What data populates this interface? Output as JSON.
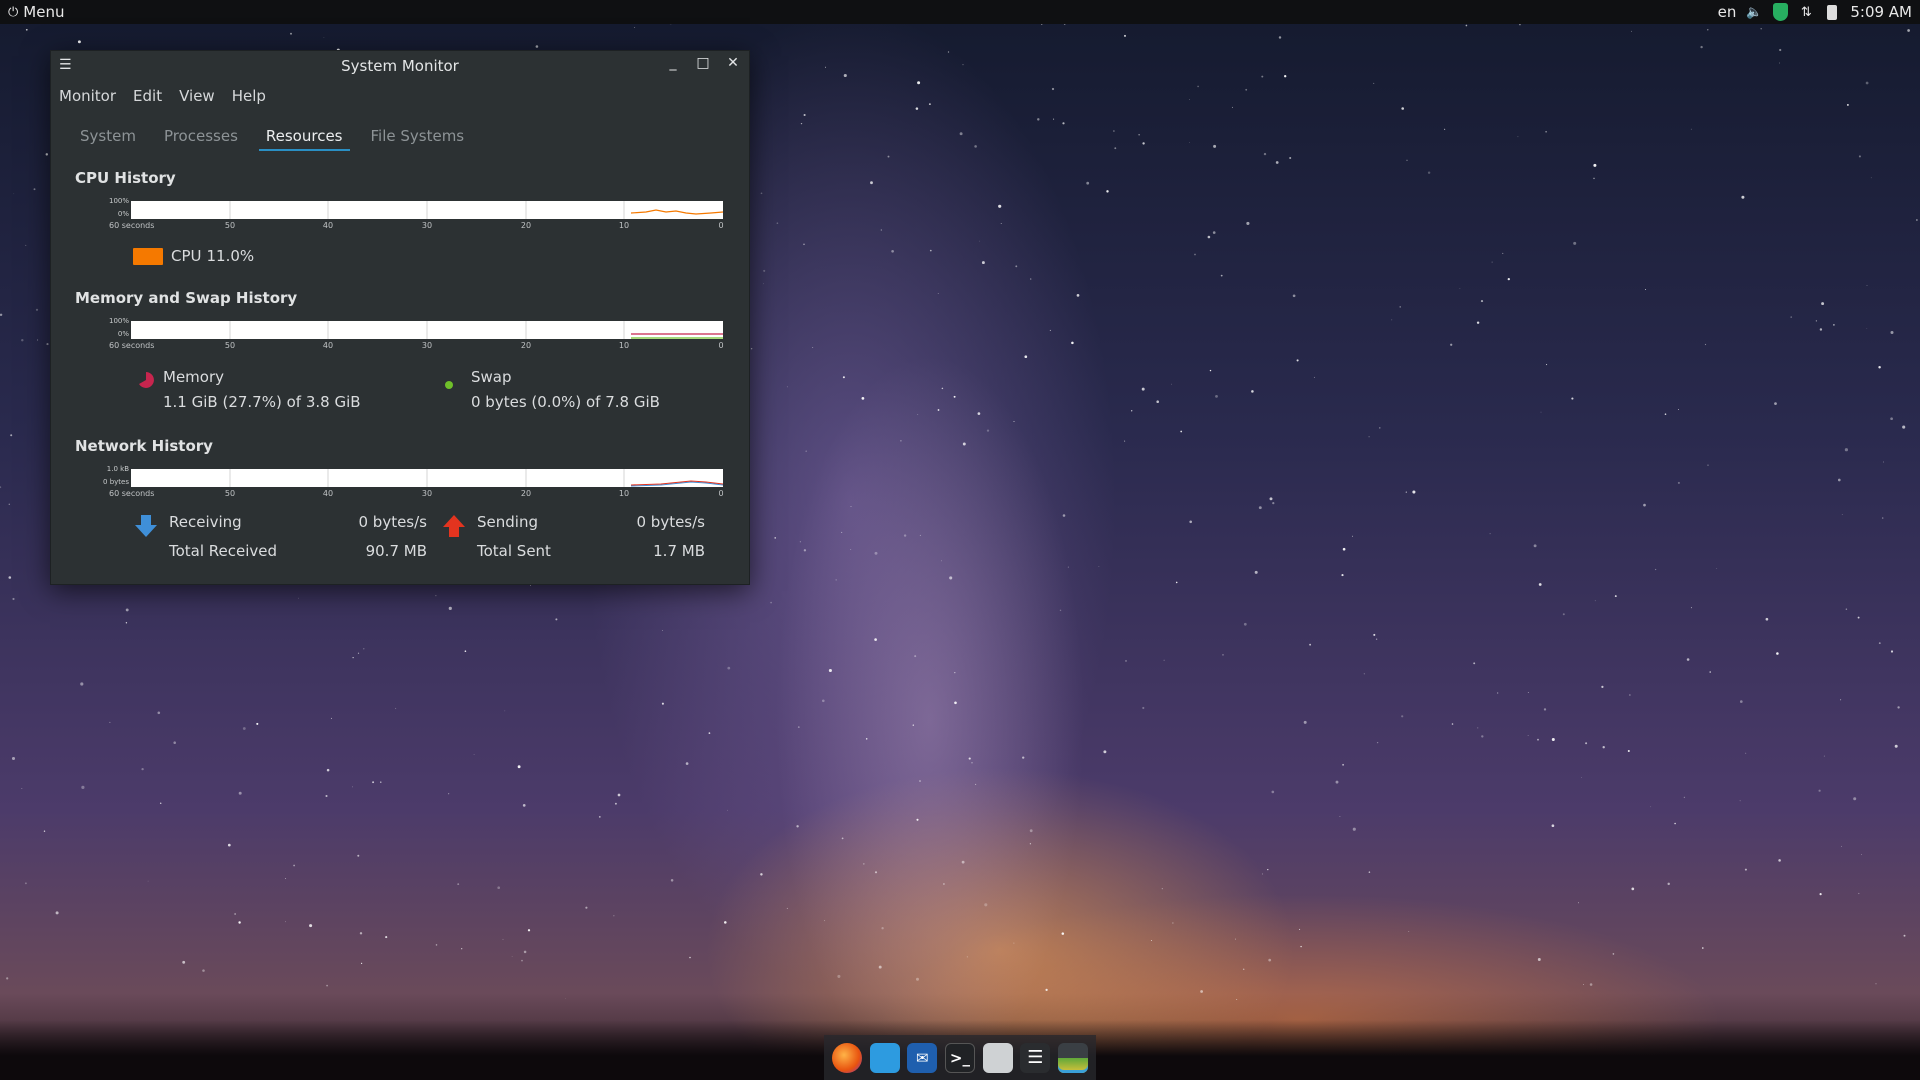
{
  "panel": {
    "menu_label": "Menu",
    "keyboard_layout": "en",
    "clock": "5:09 AM"
  },
  "window": {
    "title": "System Monitor",
    "menu": [
      "Monitor",
      "Edit",
      "View",
      "Help"
    ],
    "tabs": [
      "System",
      "Processes",
      "Resources",
      "File Systems"
    ],
    "active_tab": "Resources"
  },
  "cpu": {
    "title": "CPU History",
    "y_top": "100%",
    "y_bottom": "0%",
    "x_first": "60 seconds",
    "x_ticks": [
      "50",
      "40",
      "30",
      "20",
      "10",
      "0"
    ],
    "legend_label": "CPU",
    "legend_value": "11.0%",
    "color": "#f57900"
  },
  "memory": {
    "title": "Memory and Swap History",
    "y_top": "100%",
    "y_bottom": "0%",
    "x_first": "60 seconds",
    "x_ticks": [
      "50",
      "40",
      "30",
      "20",
      "10",
      "0"
    ],
    "memory_label": "Memory",
    "memory_value": "1.1 GiB (27.7%) of 3.8 GiB",
    "memory_color": "#c7254e",
    "swap_label": "Swap",
    "swap_value": "0 bytes (0.0%) of 7.8 GiB",
    "swap_color": "#6fbf2a"
  },
  "network": {
    "title": "Network History",
    "y_top": "1.0 kB",
    "y_bottom": "0 bytes",
    "x_first": "60 seconds",
    "x_ticks": [
      "50",
      "40",
      "30",
      "20",
      "10",
      "0"
    ],
    "receiving_label": "Receiving",
    "receiving_rate": "0 bytes/s",
    "total_received_label": "Total Received",
    "total_received": "90.7 MB",
    "sending_label": "Sending",
    "sending_rate": "0 bytes/s",
    "total_sent_label": "Total Sent",
    "total_sent": "1.7 MB",
    "receive_color": "#3f8fd8",
    "send_color": "#e3341f"
  },
  "dock": {
    "icons": [
      "firefox-icon",
      "files-icon",
      "thunderbird-icon",
      "terminal-icon",
      "text-editor-icon",
      "task-list-icon",
      "system-monitor-icon"
    ]
  }
}
